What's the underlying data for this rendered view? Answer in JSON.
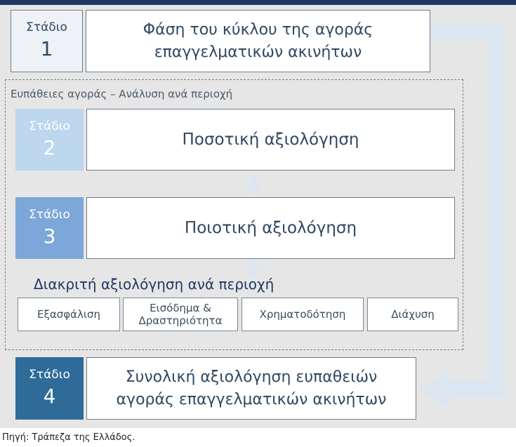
{
  "stages": [
    {
      "label": "Στάδιο",
      "number": "1",
      "title_lines": [
        "Φάση του κύκλου της αγοράς",
        "επαγγελματικών ακινήτων"
      ],
      "color": "#eef1f5",
      "text_color": "#2f4862"
    },
    {
      "label": "Στάδιο",
      "number": "2",
      "title_lines": [
        "Ποσοτική αξιολόγηση"
      ],
      "color": "#bdd7ee",
      "text_color": "#ffffff"
    },
    {
      "label": "Στάδιο",
      "number": "3",
      "title_lines": [
        "Ποιοτική αξιολόγηση"
      ],
      "color": "#7da7d8",
      "text_color": "#ffffff"
    },
    {
      "label": "Στάδιο",
      "number": "4",
      "title_lines": [
        "Συνολική αξιολόγηση ευπαθειών",
        "αγοράς επαγγελματικών ακινήτων"
      ],
      "color": "#2e6b99",
      "text_color": "#ffffff"
    }
  ],
  "region_label": "Ευπάθειες αγοράς – Ανάλυση ανά περιοχή",
  "breakdown_title": "Διακριτή αξιολόγηση ανά περιοχή",
  "breakdown_items": [
    {
      "lines": [
        "Εξασφάλιση"
      ]
    },
    {
      "lines": [
        "Εισόδημα &",
        "Δραστηριότητα"
      ]
    },
    {
      "lines": [
        "Χρηματοδότηση"
      ]
    },
    {
      "lines": [
        "Διάχυση"
      ]
    }
  ],
  "source": "Πηγή: Τράπεζα της Ελλάδος.",
  "colors": {
    "arrow": "#dce6f1",
    "header_bar": "#1f3864",
    "background": "#e6e6e6"
  }
}
